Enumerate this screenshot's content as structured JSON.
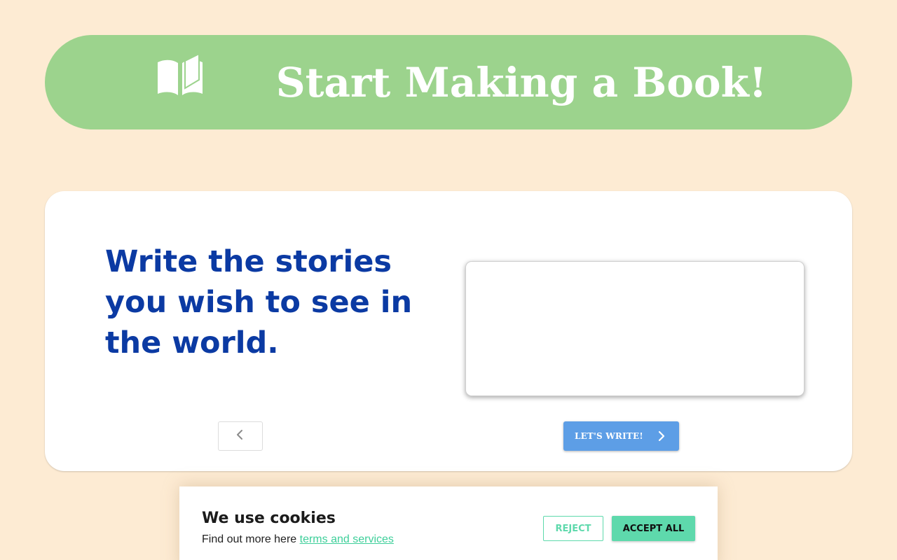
{
  "header": {
    "title": "Start Making a Book!",
    "icon": "open-book-icon",
    "color": "#9cd38d"
  },
  "hero": {
    "tagline": "Write the stories you wish to see in the world.",
    "tagline_color": "#0b3aa3"
  },
  "navigation": {
    "prev_icon": "chevron-left-icon",
    "next_label": "LET'S WRITE!",
    "next_icon": "chevron-right-icon",
    "next_color": "#5d9ee6"
  },
  "cookie_banner": {
    "title": "We use cookies",
    "text": "Find out more here ",
    "link_text": "terms and services",
    "reject_label": "REJECT",
    "accept_label": "ACCEPT ALL",
    "accent_color": "#5ed9ac"
  },
  "page": {
    "background": "#fdebd3"
  }
}
